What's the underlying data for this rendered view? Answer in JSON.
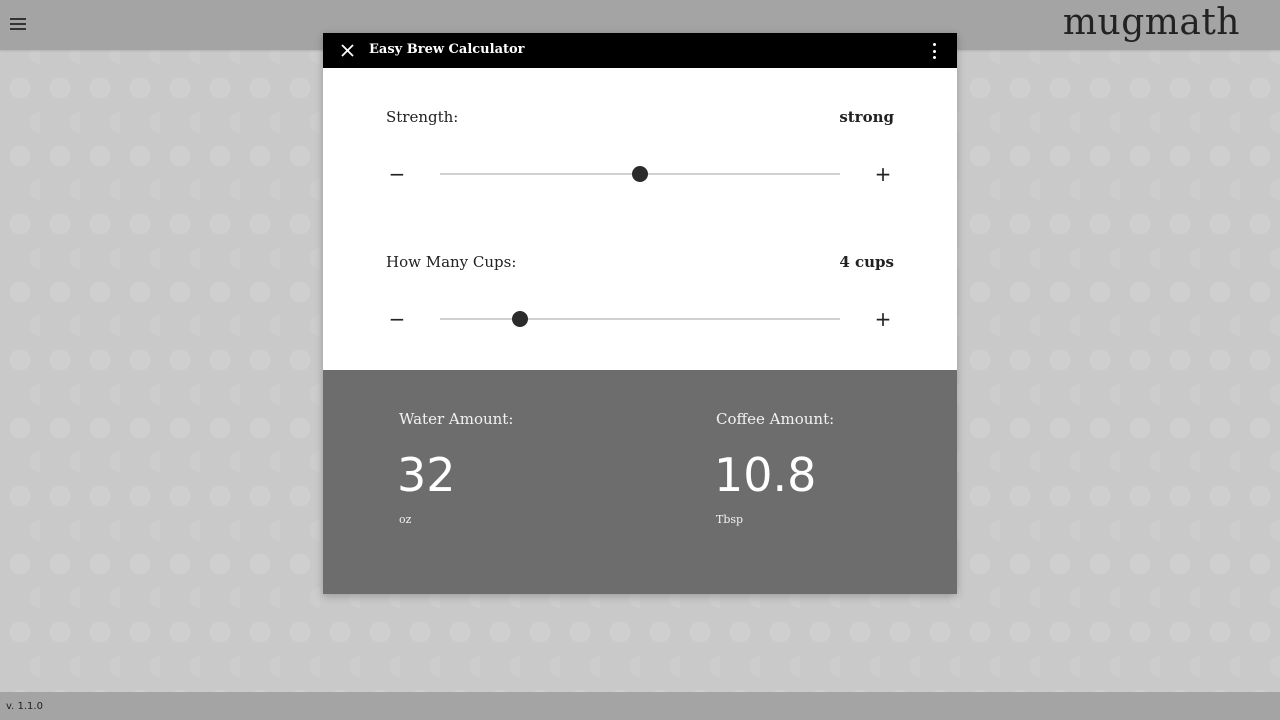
{
  "header": {
    "menu_icon": "hamburger-menu-icon",
    "brand": "mugmath"
  },
  "modal": {
    "title": "Easy Brew Calculator",
    "close_icon": "close-icon",
    "more_icon": "more-vert-icon",
    "strength": {
      "label": "Strength:",
      "value": "strong",
      "minus": "−",
      "plus": "+",
      "level": 0.5
    },
    "cups": {
      "label": "How Many Cups:",
      "value": "4 cups",
      "minus": "−",
      "plus": "+",
      "level": 0.2
    }
  },
  "results": {
    "water": {
      "label": "Water Amount:",
      "value": "32",
      "unit": "oz"
    },
    "coffee": {
      "label": "Coffee Amount:",
      "value": "10.8",
      "unit": "Tbsp"
    }
  },
  "footer": {
    "version": "v. 1.1.0"
  },
  "colors": {
    "background": "#c9c9c9",
    "topbar": "#a4a4a4",
    "modal_header": "#000000",
    "results_panel": "#6d6d6d",
    "slider_thumb": "#2b2b2b"
  }
}
